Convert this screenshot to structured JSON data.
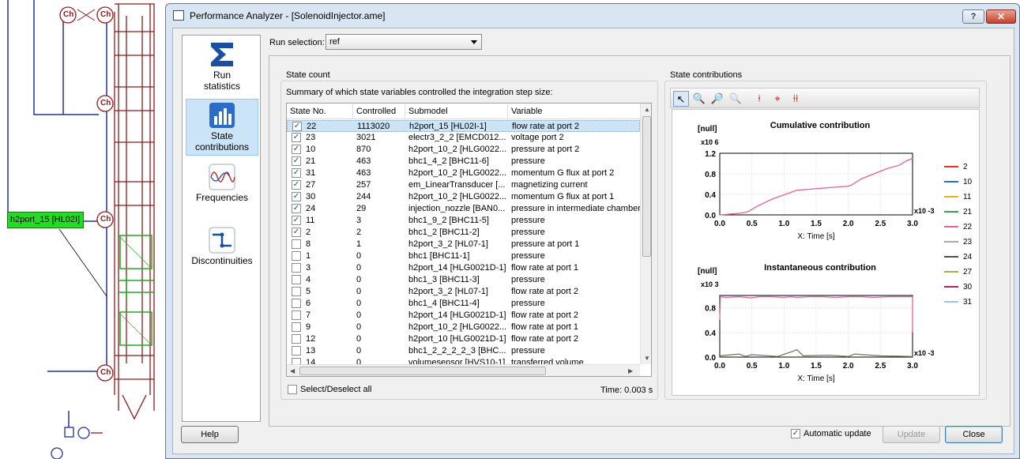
{
  "background": {
    "tooltip": "h2port_15 [HL02I]",
    "component_labels": [
      "Ch",
      "Ch",
      "Ch",
      "Ch",
      "Ch"
    ]
  },
  "window": {
    "title": "Performance Analyzer - [SolenoidInjector.ame]",
    "help_button": "?",
    "close_button": "✕"
  },
  "sidebar": {
    "items": [
      {
        "label": "Run statistics",
        "icon": "sigma-icon"
      },
      {
        "label": "State contributions",
        "icon": "bar-chart-icon",
        "selected": true
      },
      {
        "label": "Frequencies",
        "icon": "wave-icon"
      },
      {
        "label": "Discontinuities",
        "icon": "discontinuity-icon"
      }
    ]
  },
  "run_selection": {
    "label": "Run selection:",
    "value": "ref"
  },
  "state_count": {
    "title": "State count",
    "summary": "Summary of which state variables controlled the integration step size:",
    "columns": [
      "State No.",
      "Controlled",
      "Submodel",
      "Variable"
    ],
    "rows": [
      {
        "checked": true,
        "state": "22",
        "controlled": "1113020",
        "submodel": "h2port_15 [HL02I-1]",
        "variable": "flow rate at port 2",
        "selected": true
      },
      {
        "checked": true,
        "state": "23",
        "controlled": "3021",
        "submodel": "electr3_2_2 [EMCD012...",
        "variable": "voltage port 2"
      },
      {
        "checked": true,
        "state": "10",
        "controlled": "870",
        "submodel": "h2port_10_2 [HLG0022...",
        "variable": "pressure at port 2"
      },
      {
        "checked": true,
        "state": "21",
        "controlled": "463",
        "submodel": "bhc1_4_2 [BHC11-6]",
        "variable": "pressure"
      },
      {
        "checked": true,
        "state": "31",
        "controlled": "463",
        "submodel": "h2port_10_2 [HLG0022...",
        "variable": "momentum G flux at port 2"
      },
      {
        "checked": true,
        "state": "27",
        "controlled": "257",
        "submodel": "em_LinearTransducer [...",
        "variable": "magnetizing current"
      },
      {
        "checked": true,
        "state": "30",
        "controlled": "244",
        "submodel": "h2port_10_2 [HLG0022...",
        "variable": "momentum G flux at port 1"
      },
      {
        "checked": true,
        "state": "24",
        "controlled": "29",
        "submodel": "injection_nozzle [BAN0...",
        "variable": "pressure in intermediate chamber"
      },
      {
        "checked": true,
        "state": "11",
        "controlled": "3",
        "submodel": "bhc1_9_2 [BHC11-5]",
        "variable": "pressure"
      },
      {
        "checked": true,
        "state": "2",
        "controlled": "2",
        "submodel": "bhc1_2 [BHC11-2]",
        "variable": "pressure"
      },
      {
        "checked": false,
        "state": "8",
        "controlled": "1",
        "submodel": "h2port_3_2 [HL07-1]",
        "variable": "pressure at port 1"
      },
      {
        "checked": false,
        "state": "1",
        "controlled": "0",
        "submodel": "bhc1 [BHC11-1]",
        "variable": "pressure"
      },
      {
        "checked": false,
        "state": "3",
        "controlled": "0",
        "submodel": "h2port_14 [HLG0021D-1]",
        "variable": "flow rate at port 1"
      },
      {
        "checked": false,
        "state": "4",
        "controlled": "0",
        "submodel": "bhc1_3 [BHC11-3]",
        "variable": "pressure"
      },
      {
        "checked": false,
        "state": "5",
        "controlled": "0",
        "submodel": "h2port_3_2 [HL07-1]",
        "variable": "flow rate at port 2"
      },
      {
        "checked": false,
        "state": "6",
        "controlled": "0",
        "submodel": "bhc1_4 [BHC11-4]",
        "variable": "pressure"
      },
      {
        "checked": false,
        "state": "7",
        "controlled": "0",
        "submodel": "h2port_14 [HLG0021D-1]",
        "variable": "flow rate at port 2"
      },
      {
        "checked": false,
        "state": "9",
        "controlled": "0",
        "submodel": "h2port_10_2 [HLG0022...",
        "variable": "flow rate at port 1"
      },
      {
        "checked": false,
        "state": "12",
        "controlled": "0",
        "submodel": "h2port_10 [HLG0021D-1]",
        "variable": "flow rate at port 2"
      },
      {
        "checked": false,
        "state": "13",
        "controlled": "0",
        "submodel": "bhc1_2_2_2_2_3 [BHC...",
        "variable": "pressure"
      },
      {
        "checked": false,
        "state": "14",
        "controlled": "0",
        "submodel": "volumesensor [HVS10-1]",
        "variable": "transferred volume"
      }
    ],
    "select_all": "Select/Deselect all",
    "time": "Time: 0.003 s"
  },
  "state_contributions": {
    "title": "State contributions",
    "toolbar": [
      "pointer-icon",
      "zoom-in-icon",
      "zoom-fit-icon",
      "zoom-out-icon",
      "marker-icon",
      "marker-move-icon",
      "marker-pair-icon"
    ]
  },
  "chart_data": [
    {
      "type": "line",
      "title": "Cumulative contribution",
      "ylabel": "[null]",
      "y_multiplier": "x10 6",
      "xlabel": "X: Time [s]",
      "x_multiplier": "x10 -3",
      "xlim": [
        0,
        3.0
      ],
      "ylim": [
        0,
        1.2
      ],
      "x_ticks": [
        "0.0",
        "0.5",
        "1.0",
        "1.5",
        "2.0",
        "2.5",
        "3.0"
      ],
      "y_ticks": [
        "0.0",
        "0.4",
        "0.8",
        "1.2"
      ],
      "series": [
        {
          "name": "22",
          "color": "#e8609a",
          "x": [
            0,
            0.1,
            0.2,
            0.3,
            0.4,
            0.45,
            0.6,
            0.8,
            1.0,
            1.2,
            1.4,
            1.6,
            1.8,
            2.0,
            2.05,
            2.2,
            2.4,
            2.6,
            2.8,
            2.9,
            3.0
          ],
          "y": [
            0,
            0.01,
            0.02,
            0.03,
            0.05,
            0.07,
            0.18,
            0.3,
            0.39,
            0.48,
            0.5,
            0.52,
            0.54,
            0.56,
            0.58,
            0.7,
            0.8,
            0.9,
            0.97,
            1.05,
            1.1
          ]
        }
      ]
    },
    {
      "type": "line",
      "title": "Instantaneous contribution",
      "ylabel": "[null]",
      "y_multiplier": "x10 3",
      "xlabel": "X: Time [s]",
      "x_multiplier": "x10 -3",
      "xlim": [
        0,
        3.0
      ],
      "ylim": [
        0,
        1.0
      ],
      "x_ticks": [
        "0.0",
        "0.5",
        "1.0",
        "1.5",
        "2.0",
        "2.5",
        "3.0"
      ],
      "y_ticks": [
        "0.0",
        "0.4",
        "0.8"
      ],
      "series": [
        {
          "name": "22",
          "color": "#e8609a",
          "x": [
            0,
            0.01,
            0.1,
            0.3,
            0.5,
            0.6,
            0.8,
            1.0,
            1.1,
            1.2,
            1.4,
            1.6,
            1.8,
            2.0,
            2.2,
            2.4,
            2.6,
            2.8,
            3.0,
            3.0
          ],
          "y": [
            0.6,
            0.98,
            0.97,
            0.98,
            0.96,
            0.98,
            0.98,
            0.97,
            0.98,
            0.97,
            0.98,
            0.98,
            0.97,
            0.98,
            0.98,
            0.97,
            0.98,
            0.98,
            0.98,
            0.4
          ]
        },
        {
          "name": "24",
          "color": "#6f7f5f",
          "x": [
            0,
            0.3,
            0.4,
            0.5,
            0.9,
            1.1,
            1.2,
            1.3,
            1.7,
            2.0,
            2.1,
            2.5,
            3.0
          ],
          "y": [
            0.02,
            0.05,
            0.01,
            0.04,
            0.01,
            0.08,
            0.12,
            0.02,
            0.03,
            0.01,
            0.05,
            0.02,
            0.01
          ]
        }
      ]
    }
  ],
  "legend": [
    {
      "name": "2",
      "color": "#e8302a"
    },
    {
      "name": "10",
      "color": "#2a72c4"
    },
    {
      "name": "11",
      "color": "#f0b020"
    },
    {
      "name": "21",
      "color": "#38a848"
    },
    {
      "name": "22",
      "color": "#e8609a"
    },
    {
      "name": "23",
      "color": "#a8a8a8"
    },
    {
      "name": "24",
      "color": "#505050"
    },
    {
      "name": "27",
      "color": "#a8b050"
    },
    {
      "name": "30",
      "color": "#a82a50"
    },
    {
      "name": "31",
      "color": "#98c8e8"
    }
  ],
  "footer": {
    "help": "Help",
    "auto_update": "Automatic update",
    "update": "Update",
    "close": "Close"
  }
}
